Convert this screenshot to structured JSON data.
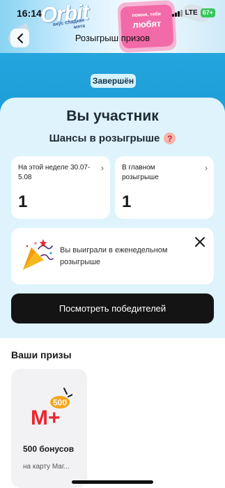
{
  "status_bar": {
    "time": "16:14",
    "network": "LTE",
    "battery": "67+"
  },
  "banner": {
    "brand": "Orbit",
    "flavor": "вкус сладкая мята",
    "pack_subtext": "помни, тебя",
    "pack_main": "любят"
  },
  "header": {
    "title": "Розыгрыш призов",
    "back_icon": "chevron-left-icon"
  },
  "status_badge": "Завершён",
  "participation": {
    "title": "Вы участник",
    "subtitle": "Шансы в розыгрыше",
    "help_icon": "?",
    "cards": [
      {
        "label": "На этой неделе 30.07-5.08",
        "value": "1"
      },
      {
        "label": "В главном розыгрыше",
        "value": "1"
      }
    ]
  },
  "win_notice": {
    "text": "Вы выиграли в еженедельном розыгрыше"
  },
  "winners_button": "Посмотреть победителей",
  "prizes": {
    "section_title": "Ваши призы",
    "items": [
      {
        "logo_badge": "500",
        "logo_text": "M+",
        "name": "500 бонусов",
        "description": "на карту Маг..."
      }
    ]
  },
  "colors": {
    "sheet_bg": "#def3fc",
    "banner_blue": "#22a3dc",
    "button_bg": "#141415",
    "accent_red": "#e8282f",
    "badge_orange": "#f7a41e",
    "battery_green": "#34c759"
  }
}
